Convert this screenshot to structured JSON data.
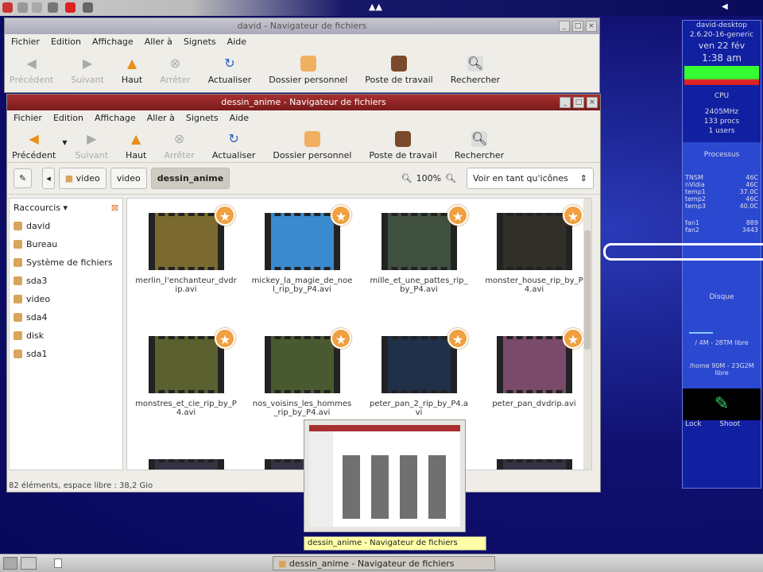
{
  "top_panel": {
    "icons": [
      "menu-icon",
      "terminal-icon",
      "firefox-icon",
      "download-icon",
      "power-icon"
    ],
    "center_icons": "▲▲"
  },
  "back_window": {
    "title": "david - Navigateur de fichiers",
    "menu": [
      "Fichier",
      "Edition",
      "Affichage",
      "Aller à",
      "Signets",
      "Aide"
    ],
    "toolbar": [
      "Précédent",
      "Suivant",
      "Haut",
      "Arrêter",
      "Actualiser",
      "Dossier personnel",
      "Poste de travail",
      "Rechercher"
    ]
  },
  "front_window": {
    "title": "dessin_anime - Navigateur de fichiers",
    "menu": [
      "Fichier",
      "Edition",
      "Affichage",
      "Aller à",
      "Signets",
      "Aide"
    ],
    "toolbar": [
      "Précédent",
      "Suivant",
      "Haut",
      "Arrêter",
      "Actualiser",
      "Dossier personnel",
      "Poste de travail",
      "Rechercher"
    ],
    "breadcrumbs": [
      "video",
      "video",
      "dessin_anime"
    ],
    "zoom": "100%",
    "view_select": "Voir en tant qu'icônes",
    "sidebar_title": "Raccourcis",
    "sidebar": [
      "david",
      "Bureau",
      "Système de fichiers",
      "sda3",
      "video",
      "sda4",
      "disk",
      "sda1"
    ],
    "files": [
      "merlin_l'enchanteur_dvdrip.avi",
      "mickey_la_magie_de_noel_rip_by_P4.avi",
      "mille_et_une_pattes_rip_by_P4.avi",
      "monster_house_rip_by_P4.avi",
      "monstres_et_cie_rip_by_P4.avi",
      "nos_voisins_les_hommes_rip_by_P4.avi",
      "peter_pan_2_rip_by_P4.avi",
      "peter_pan_dvdrip.avi"
    ],
    "status": "82 éléments, espace libre : 38,2 Gio"
  },
  "conky": {
    "host": "david-desktop",
    "kernel": "2.6.20-16-generic",
    "date": "ven 22 fév",
    "time": "1:38 am",
    "cpu_label": "CPU",
    "freq": "2405MHz",
    "procs": "133 procs",
    "users": "1 users",
    "processes_label": "Processus",
    "temps": [
      [
        "TNSM",
        "46C"
      ],
      [
        "nVidia",
        "46C"
      ],
      [
        "temp1",
        "37.0C"
      ],
      [
        "temp2",
        "46C"
      ],
      [
        "temp3",
        "40.0C"
      ]
    ],
    "fans": [
      [
        "fan1",
        "889"
      ],
      [
        "fan2",
        "3443"
      ]
    ],
    "disk_label": "Disque",
    "disk1": "/ 4M - 28TM libre",
    "disk2": "/home 90M - 23G2M libre",
    "lock": "Lock",
    "shoot": "Shoot",
    "logo": "xos"
  },
  "tooltip": "dessin_anime - Navigateur de fichiers",
  "taskbar": {
    "item": "dessin_anime - Navigateur de fichiers"
  }
}
